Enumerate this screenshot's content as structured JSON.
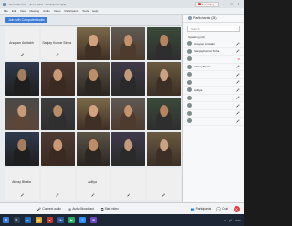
{
  "titlebar": {
    "items": [
      "Zoom Meeting",
      "Zoom Chat",
      "Participants (24)"
    ],
    "recording_label": "Recording...",
    "minimize": "–",
    "maximize": "□",
    "close": "×"
  },
  "menubar": {
    "items": [
      "File",
      "Edit",
      "View",
      "Meeting",
      "Audio",
      "Video",
      "Participants",
      "Tools",
      "Help"
    ]
  },
  "ribbon": {
    "audio_button": "Join with Computer Audio"
  },
  "gallery": {
    "tiles": [
      {
        "name": "Anupam Amitabh",
        "blank": true,
        "mic": "🎤"
      },
      {
        "name": "Sanjay Kumar Sinha",
        "blank": true,
        "mic": "🎤"
      },
      {
        "name": "",
        "blank": false,
        "mic": ""
      },
      {
        "name": "",
        "blank": false,
        "mic": ""
      },
      {
        "name": "",
        "blank": false,
        "mic": ""
      },
      {
        "name": "",
        "blank": false,
        "mic": ""
      },
      {
        "name": "",
        "blank": false,
        "mic": ""
      },
      {
        "name": "",
        "blank": false,
        "mic": ""
      },
      {
        "name": "",
        "blank": false,
        "mic": ""
      },
      {
        "name": "",
        "blank": false,
        "mic": ""
      },
      {
        "name": "",
        "blank": false,
        "mic": ""
      },
      {
        "name": "",
        "blank": false,
        "mic": ""
      },
      {
        "name": "",
        "blank": false,
        "mic": ""
      },
      {
        "name": "",
        "blank": false,
        "mic": ""
      },
      {
        "name": "",
        "blank": false,
        "mic": ""
      },
      {
        "name": "",
        "blank": false,
        "mic": ""
      },
      {
        "name": "",
        "blank": false,
        "mic": ""
      },
      {
        "name": "",
        "blank": false,
        "mic": ""
      },
      {
        "name": "",
        "blank": false,
        "mic": ""
      },
      {
        "name": "",
        "blank": false,
        "mic": ""
      },
      {
        "name": "Abhay Bhatia",
        "blank": true,
        "mic": "🎤"
      },
      {
        "name": "",
        "blank": true,
        "mic": "🎤"
      },
      {
        "name": "Aditya",
        "blank": true,
        "mic": "🎤"
      },
      {
        "name": "",
        "blank": true,
        "mic": "🎤"
      },
      {
        "name": "",
        "blank": true,
        "mic": "🎤"
      }
    ]
  },
  "panel": {
    "title": "Participants (24)",
    "search_placeholder": "Search",
    "section_label": "Speaking (24)",
    "participants": [
      {
        "name": "Anupam Amitabh",
        "mic": "on"
      },
      {
        "name": "Sanjay Kumar Sinha",
        "mic": "on"
      },
      {
        "name": "",
        "mic": "off"
      },
      {
        "name": "Abhay Bhatia",
        "mic": "on"
      },
      {
        "name": "",
        "mic": "on"
      },
      {
        "name": "",
        "mic": "on"
      },
      {
        "name": "Aditya",
        "mic": "on"
      },
      {
        "name": "",
        "mic": "on"
      },
      {
        "name": "",
        "mic": "on"
      },
      {
        "name": "",
        "mic": "on"
      },
      {
        "name": "",
        "mic": "on"
      }
    ]
  },
  "toolbar": {
    "left": [
      {
        "icon": "🎤",
        "label": "Connect audio"
      },
      {
        "icon": "⊕",
        "label": "Audio Broadcast"
      },
      {
        "icon": "⧉",
        "label": "Start video"
      }
    ],
    "right": [
      {
        "icon": "👥",
        "label": "Participants"
      },
      {
        "icon": "💬",
        "label": "Chat"
      }
    ],
    "leave_icon": "✕"
  },
  "taskbar": {
    "icons": [
      {
        "glyph": "⊞",
        "color": "#3a7bd5"
      },
      {
        "glyph": "🔍",
        "color": "#2c3e50"
      },
      {
        "glyph": "e",
        "color": "#1f6fbf"
      },
      {
        "glyph": "📁",
        "color": "#d8a13a"
      },
      {
        "glyph": "●",
        "color": "#c0392b"
      },
      {
        "glyph": "W",
        "color": "#2b579a"
      },
      {
        "glyph": "▶",
        "color": "#27ae60"
      },
      {
        "glyph": "Z",
        "color": "#2d8cff"
      },
      {
        "glyph": "✉",
        "color": "#6f42c1"
      }
    ],
    "tray": [
      "^",
      "🔊",
      "ENG"
    ]
  }
}
